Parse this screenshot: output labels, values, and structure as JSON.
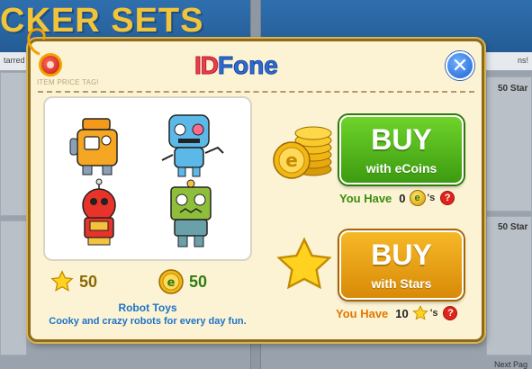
{
  "background": {
    "title": "CKER SETS",
    "strip_left": "tarred",
    "strip_right": "ns!",
    "stars_top": "50 Star",
    "stars_bottom": "50 Star",
    "next_page": "Next Pag"
  },
  "modal": {
    "tag_label": "ITEM PRICE TAG!",
    "logo_id": "ID",
    "logo_fone": "Fone",
    "close_glyph": "✕",
    "item": {
      "name": "Robot Toys",
      "description": "Cooky and crazy robots for every day fun.",
      "price_stars": "50",
      "price_coins": "50"
    },
    "buy_ecoins": {
      "big": "BUY",
      "small": "with eCoins"
    },
    "buy_stars": {
      "big": "BUY",
      "small": "with Stars"
    },
    "have_ecoins": {
      "label": "You Have",
      "value": "0",
      "suffix": "'s",
      "help": "?"
    },
    "have_stars": {
      "label": "You Have",
      "value": "10",
      "suffix": "'s",
      "help": "?"
    }
  },
  "icons": [
    "star-icon",
    "ecoin-icon",
    "coin-stack-icon",
    "help-icon",
    "close-icon",
    "price-tag-icon"
  ],
  "colors": {
    "buy_ecoins": "#3c9b10",
    "buy_stars": "#d88a08",
    "header_blue": "#2f6fae",
    "title_gold": "#f2c43a",
    "text_blue": "#1f73c8"
  }
}
